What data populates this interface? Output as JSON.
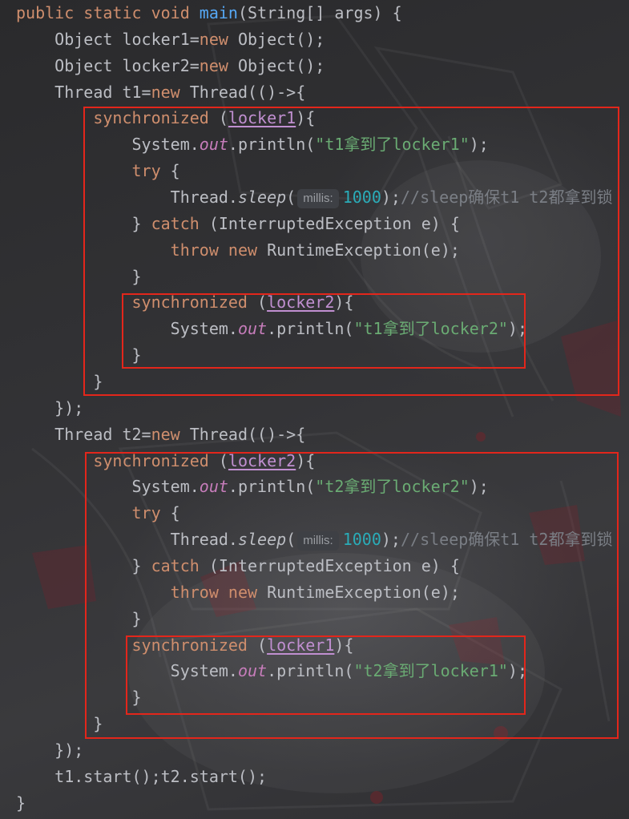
{
  "editor": {
    "language": "Java",
    "syntax_colors": {
      "plain": "#BCBEC4",
      "kw": "#CF8E6D",
      "fn": "#56A8F5",
      "field": "#C77DBB",
      "str": "#6AAB73",
      "num": "#2AACB8",
      "comment": "#7A7E85",
      "capt": "#C08FD0",
      "hint": "#9A9DA2",
      "hint-bg": "#3E4045"
    },
    "highlight_color": "#E3261B",
    "lines": [
      {
        "indent": 0,
        "tokens": [
          {
            "t": "public",
            "k": "kw"
          },
          {
            "t": " static",
            "k": "kw"
          },
          {
            "t": " void",
            "k": "kw"
          },
          {
            "t": " main",
            "k": "fn"
          },
          {
            "t": "(String[] args) {",
            "k": "plain"
          }
        ]
      },
      {
        "indent": 1,
        "tokens": [
          {
            "t": "Object locker1=",
            "k": "plain"
          },
          {
            "t": "new",
            "k": "kw"
          },
          {
            "t": " Object();",
            "k": "plain"
          }
        ]
      },
      {
        "indent": 1,
        "tokens": [
          {
            "t": "Object locker2=",
            "k": "plain"
          },
          {
            "t": "new",
            "k": "kw"
          },
          {
            "t": " Object();",
            "k": "plain"
          }
        ]
      },
      {
        "indent": 1,
        "tokens": [
          {
            "t": "Thread t1=",
            "k": "plain"
          },
          {
            "t": "new",
            "k": "kw"
          },
          {
            "t": " Thread(()->{",
            "k": "plain"
          }
        ]
      },
      {
        "indent": 2,
        "tokens": [
          {
            "t": "synchronized",
            "k": "kw"
          },
          {
            "t": " (",
            "k": "plain"
          },
          {
            "t": "locker1",
            "k": "capt"
          },
          {
            "t": "){",
            "k": "plain"
          }
        ]
      },
      {
        "indent": 3,
        "tokens": [
          {
            "t": "System.",
            "k": "plain"
          },
          {
            "t": "out",
            "k": "field"
          },
          {
            "t": ".println(",
            "k": "plain"
          },
          {
            "t": "\"t1拿到了locker1\"",
            "k": "str"
          },
          {
            "t": ");",
            "k": "plain"
          }
        ]
      },
      {
        "indent": 3,
        "tokens": [
          {
            "t": "try",
            "k": "kw"
          },
          {
            "t": " {",
            "k": "plain"
          }
        ]
      },
      {
        "indent": 4,
        "tokens": [
          {
            "t": "Thread.",
            "k": "plain"
          },
          {
            "t": "sleep",
            "k": "static"
          },
          {
            "t": "(",
            "k": "plain"
          },
          {
            "t": "millis:",
            "k": "hint"
          },
          {
            "t": "1000",
            "k": "num"
          },
          {
            "t": ");",
            "k": "plain"
          },
          {
            "t": "//sleep确保t1 t2都拿到锁",
            "k": "comment"
          }
        ]
      },
      {
        "indent": 3,
        "tokens": [
          {
            "t": "} ",
            "k": "plain"
          },
          {
            "t": "catch",
            "k": "kw"
          },
          {
            "t": " (InterruptedException e) {",
            "k": "plain"
          }
        ]
      },
      {
        "indent": 4,
        "tokens": [
          {
            "t": "throw",
            "k": "kw"
          },
          {
            "t": " new",
            "k": "kw"
          },
          {
            "t": " RuntimeException(e);",
            "k": "plain"
          }
        ]
      },
      {
        "indent": 3,
        "tokens": [
          {
            "t": "}",
            "k": "plain"
          }
        ]
      },
      {
        "indent": 3,
        "tokens": [
          {
            "t": "synchronized",
            "k": "kw"
          },
          {
            "t": " (",
            "k": "plain"
          },
          {
            "t": "locker2",
            "k": "capt"
          },
          {
            "t": "){",
            "k": "plain"
          }
        ]
      },
      {
        "indent": 4,
        "tokens": [
          {
            "t": "System.",
            "k": "plain"
          },
          {
            "t": "out",
            "k": "field"
          },
          {
            "t": ".println(",
            "k": "plain"
          },
          {
            "t": "\"t1拿到了locker2\"",
            "k": "str"
          },
          {
            "t": ");",
            "k": "plain"
          }
        ]
      },
      {
        "indent": 3,
        "tokens": [
          {
            "t": "}",
            "k": "plain"
          }
        ]
      },
      {
        "indent": 2,
        "tokens": [
          {
            "t": "}",
            "k": "plain"
          }
        ]
      },
      {
        "indent": 1,
        "tokens": [
          {
            "t": "});",
            "k": "plain"
          }
        ]
      },
      {
        "indent": 1,
        "tokens": [
          {
            "t": "Thread t2=",
            "k": "plain"
          },
          {
            "t": "new",
            "k": "kw"
          },
          {
            "t": " Thread(()->{",
            "k": "plain"
          }
        ]
      },
      {
        "indent": 2,
        "tokens": [
          {
            "t": "synchronized",
            "k": "kw"
          },
          {
            "t": " (",
            "k": "plain"
          },
          {
            "t": "locker2",
            "k": "capt"
          },
          {
            "t": "){",
            "k": "plain"
          }
        ]
      },
      {
        "indent": 3,
        "tokens": [
          {
            "t": "System.",
            "k": "plain"
          },
          {
            "t": "out",
            "k": "field"
          },
          {
            "t": ".println(",
            "k": "plain"
          },
          {
            "t": "\"t2拿到了locker2\"",
            "k": "str"
          },
          {
            "t": ");",
            "k": "plain"
          }
        ]
      },
      {
        "indent": 3,
        "tokens": [
          {
            "t": "try",
            "k": "kw"
          },
          {
            "t": " {",
            "k": "plain"
          }
        ]
      },
      {
        "indent": 4,
        "tokens": [
          {
            "t": "Thread.",
            "k": "plain"
          },
          {
            "t": "sleep",
            "k": "static"
          },
          {
            "t": "(",
            "k": "plain"
          },
          {
            "t": "millis:",
            "k": "hint"
          },
          {
            "t": "1000",
            "k": "num"
          },
          {
            "t": ");",
            "k": "plain"
          },
          {
            "t": "//sleep确保t1 t2都拿到锁",
            "k": "comment"
          }
        ]
      },
      {
        "indent": 3,
        "tokens": [
          {
            "t": "} ",
            "k": "plain"
          },
          {
            "t": "catch",
            "k": "kw"
          },
          {
            "t": " (InterruptedException e) {",
            "k": "plain"
          }
        ]
      },
      {
        "indent": 4,
        "tokens": [
          {
            "t": "throw",
            "k": "kw"
          },
          {
            "t": " new",
            "k": "kw"
          },
          {
            "t": " RuntimeException(e);",
            "k": "plain"
          }
        ]
      },
      {
        "indent": 3,
        "tokens": [
          {
            "t": "}",
            "k": "plain"
          }
        ]
      },
      {
        "indent": 3,
        "tokens": [
          {
            "t": "synchronized",
            "k": "kw"
          },
          {
            "t": " (",
            "k": "plain"
          },
          {
            "t": "locker1",
            "k": "capt"
          },
          {
            "t": "){",
            "k": "plain"
          }
        ]
      },
      {
        "indent": 4,
        "tokens": [
          {
            "t": "System.",
            "k": "plain"
          },
          {
            "t": "out",
            "k": "field"
          },
          {
            "t": ".println(",
            "k": "plain"
          },
          {
            "t": "\"t2拿到了locker1\"",
            "k": "str"
          },
          {
            "t": ");",
            "k": "plain"
          }
        ]
      },
      {
        "indent": 3,
        "tokens": [
          {
            "t": "}",
            "k": "plain"
          }
        ]
      },
      {
        "indent": 2,
        "tokens": [
          {
            "t": "}",
            "k": "plain"
          }
        ]
      },
      {
        "indent": 1,
        "tokens": [
          {
            "t": "});",
            "k": "plain"
          }
        ]
      },
      {
        "indent": 1,
        "tokens": [
          {
            "t": "t1.start();t2.start();",
            "k": "plain"
          }
        ]
      },
      {
        "indent": 0,
        "tokens": [
          {
            "t": "}",
            "k": "plain"
          }
        ]
      }
    ]
  }
}
